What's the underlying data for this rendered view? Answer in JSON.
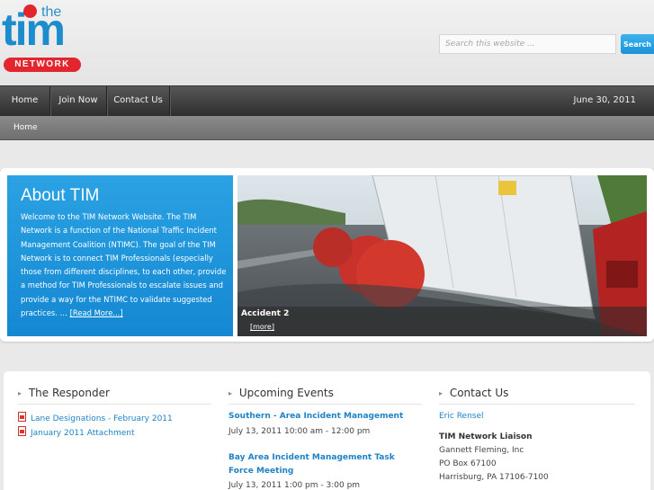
{
  "brand": {
    "logo_top": "the",
    "logo_main": "tim",
    "logo_badge": "NETWORK"
  },
  "search": {
    "placeholder": "Search this website ...",
    "button_label": "Search"
  },
  "nav": {
    "items": [
      "Home",
      "Join Now",
      "Contact Us"
    ],
    "date": "June 30, 2011"
  },
  "breadcrumb": "Home",
  "about": {
    "title": "About TIM",
    "body": "Welcome to the TIM Network Website. The TIM Network is a function of the National Traffic Incident Management Coalition (NTIMC). The goal of the TIM Network is to connect TIM Professionals (especially those from different disciplines, to each other, provide a method for TIM Professionals to escalate issues and provide a way for the NTIMC to validate suggested practices. …",
    "read_more": "[Read More...]"
  },
  "slide": {
    "caption": "Accident 2",
    "more": "[more]"
  },
  "responder": {
    "title": "The Responder",
    "links": [
      "Lane Designations - February 2011",
      "January 2011 Attachment"
    ]
  },
  "events": {
    "title": "Upcoming Events",
    "items": [
      {
        "name": "Southern - Area Incident Management",
        "time": "July 13, 2011 10:00 am - 12:00 pm"
      },
      {
        "name": "Bay Area Incident Management Task Force Meeting",
        "time": "July 13, 2011 1:00 pm - 3:00 pm"
      }
    ]
  },
  "contact": {
    "title": "Contact Us",
    "name": "Eric Rensel",
    "role": "TIM Network Liaison",
    "company": "Gannett Fleming, Inc",
    "pobox": "PO Box 67100",
    "city": "Harrisburg, PA 17106-7100"
  },
  "colors": {
    "brand_blue": "#1d8ccd",
    "brand_red": "#e3262d",
    "link_blue": "#1e82c6",
    "nav_dark": "#3a3a3a"
  }
}
